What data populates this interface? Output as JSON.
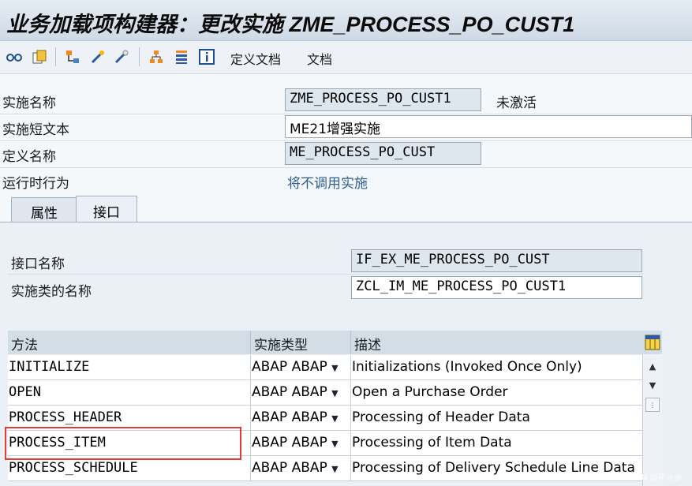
{
  "window": {
    "title": "业务加载项构建器：更改实施 ZME_PROCESS_PO_CUST1"
  },
  "toolbar": {
    "icons": [
      "glasses-icon",
      "copy-icon",
      "hierarchy-icon",
      "wand-icon",
      "wand-icon",
      "tree-icon",
      "list-icon",
      "info-icon"
    ],
    "define_doc": "定义文档",
    "doc": "文档"
  },
  "form": {
    "impl_name_label": "实施名称",
    "impl_name_value": "ZME_PROCESS_PO_CUST1",
    "impl_status": "未激活",
    "short_text_label": "实施短文本",
    "short_text_value": "ME21增强实施",
    "def_name_label": "定义名称",
    "def_name_value": "ME_PROCESS_PO_CUST",
    "runtime_label": "运行时行为",
    "runtime_value": "将不调用实施"
  },
  "tabs": [
    {
      "label": "属性"
    },
    {
      "label": "接口"
    }
  ],
  "interface": {
    "name_label": "接口名称",
    "name_value": "IF_EX_ME_PROCESS_PO_CUST",
    "class_label": "实施类的名称",
    "class_value": "ZCL_IM_ME_PROCESS_PO_CUST1"
  },
  "table": {
    "headers": [
      "方法",
      "实施类型",
      "描述"
    ],
    "rows": [
      {
        "method": "INITIALIZE",
        "type": "ABAP ABAP",
        "desc": "Initializations (Invoked Once Only)"
      },
      {
        "method": "OPEN",
        "type": "ABAP ABAP",
        "desc": "Open a Purchase Order"
      },
      {
        "method": "PROCESS_HEADER",
        "type": "ABAP ABAP",
        "desc": "Processing of Header Data"
      },
      {
        "method": "PROCESS_ITEM",
        "type": "ABAP ABAP",
        "desc": "Processing of Item Data"
      },
      {
        "method": "PROCESS_SCHEDULE",
        "type": "ABAP ABAP",
        "desc": "Processing of Delivery Schedule Line Data"
      }
    ]
  },
  "watermark": "CSDN @邓@@",
  "colors": {
    "highlight_box": "#e03a3a",
    "link_text": "#2f5f8f"
  }
}
